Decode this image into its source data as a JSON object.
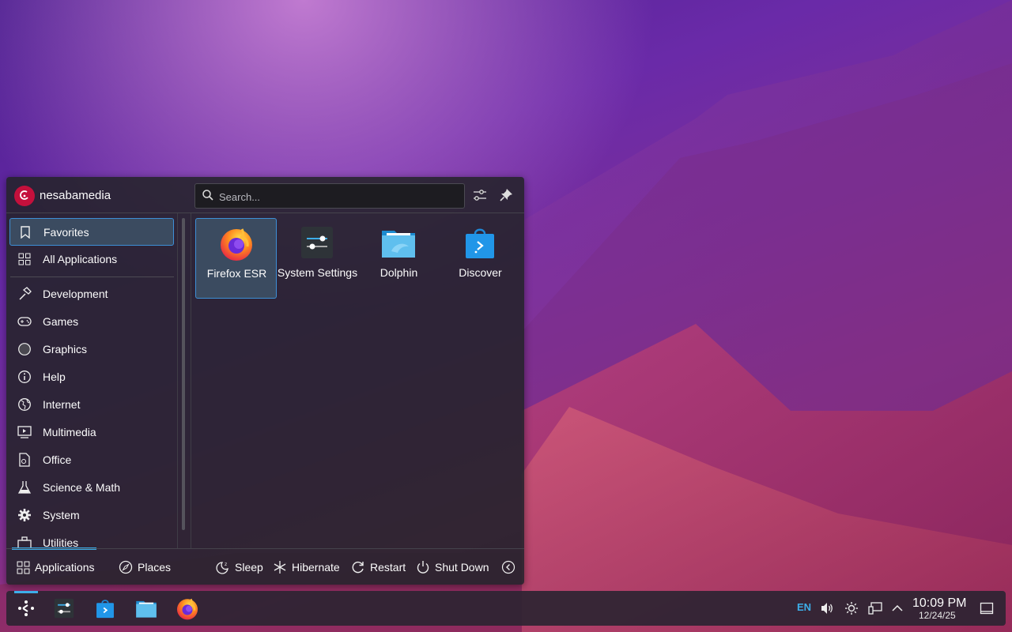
{
  "launcher": {
    "user_name": "nesabamedia",
    "search_placeholder": "Search...",
    "categories": [
      {
        "label": "Favorites",
        "icon": "bookmark-icon"
      },
      {
        "label": "All Applications",
        "icon": "grid-icon"
      },
      {
        "label": "Development",
        "icon": "hammer-icon"
      },
      {
        "label": "Games",
        "icon": "gamepad-icon"
      },
      {
        "label": "Graphics",
        "icon": "graphics-icon"
      },
      {
        "label": "Help",
        "icon": "info-icon"
      },
      {
        "label": "Internet",
        "icon": "globe-icon"
      },
      {
        "label": "Multimedia",
        "icon": "media-icon"
      },
      {
        "label": "Office",
        "icon": "document-icon"
      },
      {
        "label": "Science & Math",
        "icon": "flask-icon"
      },
      {
        "label": "System",
        "icon": "gear-icon"
      },
      {
        "label": "Utilities",
        "icon": "toolbox-icon"
      }
    ],
    "favorites": [
      {
        "label": "Firefox ESR",
        "icon": "firefox-icon"
      },
      {
        "label": "System Settings",
        "icon": "settings-icon"
      },
      {
        "label": "Dolphin",
        "icon": "folder-icon"
      },
      {
        "label": "Discover",
        "icon": "store-icon"
      }
    ],
    "footer": {
      "applications": "Applications",
      "places": "Places",
      "sleep": "Sleep",
      "hibernate": "Hibernate",
      "restart": "Restart",
      "shutdown": "Shut Down"
    }
  },
  "taskbar": {
    "language": "EN",
    "time": "10:09 PM",
    "date": "12/24/25"
  },
  "colors": {
    "accent": "#3daee9",
    "selection": "#3b4b60",
    "debian_red": "#c4103c"
  }
}
